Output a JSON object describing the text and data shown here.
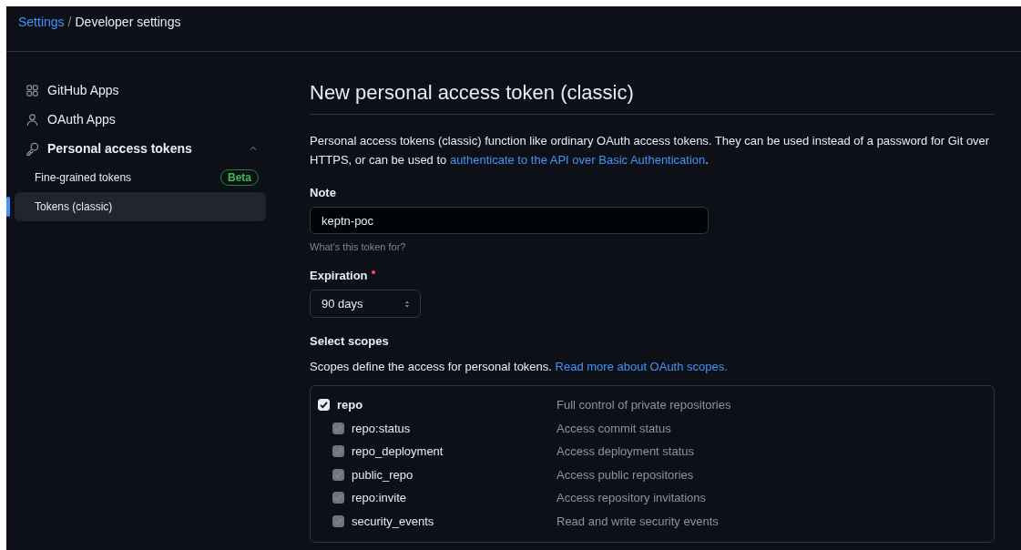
{
  "breadcrumb": [
    {
      "label": "Settings",
      "link": true
    },
    {
      "label": "Developer settings",
      "link": false
    }
  ],
  "breadcrumb_separator": "/",
  "sidebar": {
    "items": [
      {
        "label": "GitHub Apps",
        "selected": false
      },
      {
        "label": "OAuth Apps",
        "selected": false
      },
      {
        "label": "Personal access tokens",
        "expanded": true,
        "selected": false,
        "children": [
          {
            "label": "Fine-grained tokens",
            "badge": "Beta",
            "selected": false
          },
          {
            "label": "Tokens (classic)",
            "selected": true
          }
        ]
      }
    ]
  },
  "page_title": "New personal access token (classic)",
  "description": {
    "text": "Personal access tokens (classic) function like ordinary OAuth access tokens. They can be used instead of a password for Git over HTTPS, or can be used to ",
    "link": "authenticate to the API over Basic Authentication",
    "after": "."
  },
  "note": {
    "label": "Note",
    "value": "keptn-poc",
    "hint": "What's this token for?"
  },
  "expiration": {
    "label": "Expiration",
    "required": true,
    "value": "90 days"
  },
  "scopes": {
    "label": "Select scopes",
    "text": "Scopes define the access for personal tokens. ",
    "link": "Read more about OAuth scopes.",
    "items": [
      {
        "name": "repo",
        "description": "Full control of private repositories",
        "checked": true,
        "disabled": false,
        "children": [
          {
            "name": "repo:status",
            "description": "Access commit status",
            "checked": true,
            "disabled": true
          },
          {
            "name": "repo_deployment",
            "description": "Access deployment status",
            "checked": true,
            "disabled": true
          },
          {
            "name": "public_repo",
            "description": "Access public repositories",
            "checked": true,
            "disabled": true
          },
          {
            "name": "repo:invite",
            "description": "Access repository invitations",
            "checked": true,
            "disabled": true
          },
          {
            "name": "security_events",
            "description": "Read and write security events",
            "checked": true,
            "disabled": true
          }
        ]
      }
    ]
  }
}
